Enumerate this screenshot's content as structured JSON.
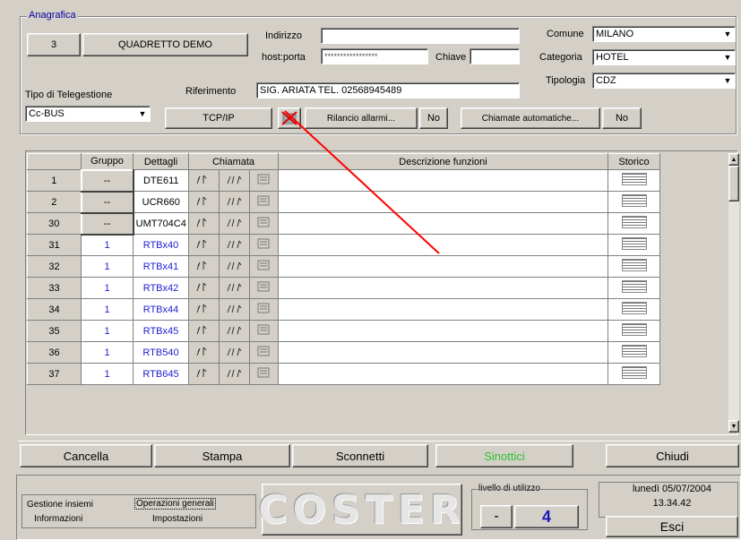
{
  "anagrafica": {
    "legend": "Anagrafica",
    "code": "3",
    "name": "QUADRETTO DEMO",
    "indirizzo_label": "Indirizzo",
    "indirizzo_value": "",
    "hostporta_label": "host:porta",
    "hostporta_value": "*****************",
    "chiave_label": "Chiave",
    "chiave_value": "",
    "comune_label": "Comune",
    "comune_value": "MILANO",
    "categoria_label": "Categoria",
    "categoria_value": "HOTEL",
    "tipologia_label": "Tipologia",
    "tipologia_value": "CDZ",
    "tipo_telegestione_label": "Tipo di Telegestione",
    "tipo_telegestione_value": "Cc-BUS",
    "riferimento_label": "Riferimento",
    "riferimento_value": "SIG. ARIATA TEL. 02568945489",
    "tcpip_label": "TCP/IP",
    "rilancio_label": "Rilancio allarmi...",
    "rilancio_value": "No",
    "chiamate_label": "Chiamate automatiche...",
    "chiamate_value": "No"
  },
  "grid": {
    "headers": {
      "gruppo": "Gruppo",
      "dettagli": "Dettagli",
      "chiamata": "Chiamata",
      "descrizione": "Descrizione funzioni",
      "storico": "Storico"
    },
    "rows": [
      {
        "id": "1",
        "gruppo": "--",
        "dettagli": "DTE611"
      },
      {
        "id": "2",
        "gruppo": "--",
        "dettagli": "UCR660"
      },
      {
        "id": "30",
        "gruppo": "--",
        "dettagli": "UMT704C4"
      },
      {
        "id": "31",
        "gruppo": "1",
        "dettagli": "RTBx40"
      },
      {
        "id": "32",
        "gruppo": "1",
        "dettagli": "RTBx41"
      },
      {
        "id": "33",
        "gruppo": "1",
        "dettagli": "RTBx42"
      },
      {
        "id": "34",
        "gruppo": "1",
        "dettagli": "RTBx44"
      },
      {
        "id": "35",
        "gruppo": "1",
        "dettagli": "RTBx45"
      },
      {
        "id": "36",
        "gruppo": "1",
        "dettagli": "RTB540"
      },
      {
        "id": "37",
        "gruppo": "1",
        "dettagli": "RTB645"
      }
    ]
  },
  "buttons": {
    "cancella": "Cancella",
    "stampa": "Stampa",
    "sconnetti": "Sconnetti",
    "sinottici": "Sinottici",
    "chiudi": "Chiudi"
  },
  "footer": {
    "gestione_insiemi": "Gestione insiemi",
    "operazioni_generali": "Operazioni generali",
    "informazioni": "Informazioni",
    "impostazioni": "Impostazioni",
    "logo": "COSTER",
    "livello_label": "livello di utilizzo",
    "livello_minus": "-",
    "livello_value": "4",
    "date": "lunedì 05/07/2004",
    "time": "13.34.42",
    "esci": "Esci"
  },
  "colors": {
    "sinottici_text": "#30c030",
    "link_blue": "#2020d0",
    "legend_blue": "#0000a0",
    "annotation_red": "#ff0000"
  }
}
